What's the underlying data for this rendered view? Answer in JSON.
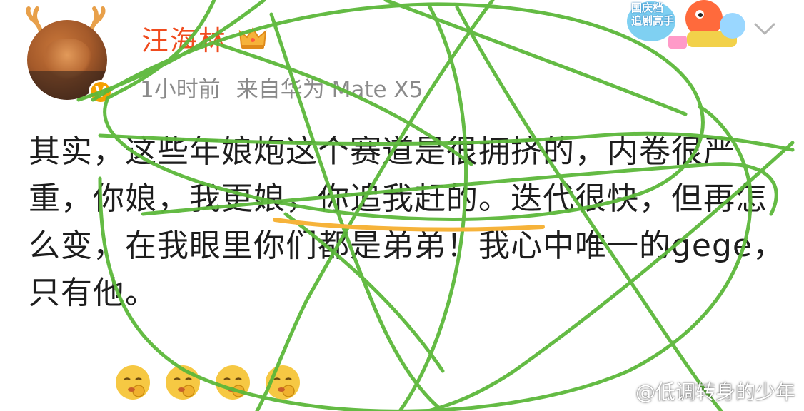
{
  "post": {
    "username": "汪海林",
    "time": "1小时前",
    "source": "来自华为 Mate X5",
    "text": "其实，这些年娘炮这个赛道是很拥挤的，内卷很严重，你娘，我更娘，你追我赶的。迭代很快，但再怎么变，在我眼里你们都是弟弟！我心中唯一的gege，只有他。",
    "highlighted_phrase": "你娘，我更娘",
    "emojis": [
      "shush-face-emoji",
      "shush-face-emoji",
      "shush-face-emoji",
      "shush-face-emoji"
    ]
  },
  "sticker": {
    "line1": "国庆档",
    "line2": "追剧高手"
  },
  "watermark": {
    "text": "@低调转身的少年"
  },
  "colors": {
    "username": "#f04b1e",
    "meta": "#8a8a8a",
    "scribble_green": "#5cb83a",
    "underline_orange": "#f6b33a",
    "verified_badge": "#f5a000"
  },
  "icons": [
    "antler-icon",
    "verified-v-icon",
    "crown-icon",
    "chevron-down-icon",
    "weibo-logo-icon"
  ]
}
